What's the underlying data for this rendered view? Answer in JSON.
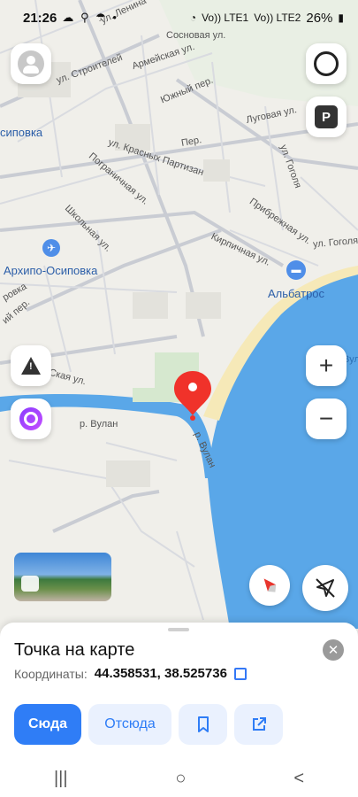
{
  "status_bar": {
    "time": "21:26",
    "signal1_label": "Vo)) LTE1",
    "signal2_label": "Vo)) LTE2",
    "battery": "26%"
  },
  "map": {
    "streets": [
      "ул. Ленина",
      "Сосновая ул.",
      "Армейская ул.",
      "ул. Строителей",
      "Южный пер.",
      "Луговая ул.",
      "ул. Красных Партизан",
      "Пограничная ул.",
      "ул. Гоголя",
      "Прибрежная ул.",
      "Школьная ул.",
      "Кирпичная ул.",
      "ул. Гоголя",
      "Пер.",
      "р. Вулан",
      "р. Вулан",
      "ровка",
      "Ская ул.",
      "Вулан",
      "ий пер."
    ],
    "places": {
      "village": "Архипо-Осиповка",
      "hotel": "Альбатрос",
      "district": "сиповка"
    }
  },
  "controls": {
    "profile_icon": "person-icon",
    "alice_icon": "alice-ring-icon",
    "parking_label": "P",
    "zoom_in": "+",
    "zoom_out": "−"
  },
  "sheet": {
    "title": "Точка на карте",
    "coords_label": "Координаты:",
    "coords_value": "44.358531, 38.525736",
    "btn_here": "Сюда",
    "btn_from": "Отсюда"
  },
  "nav": {
    "recent": "|||",
    "home": "○",
    "back": "<"
  }
}
